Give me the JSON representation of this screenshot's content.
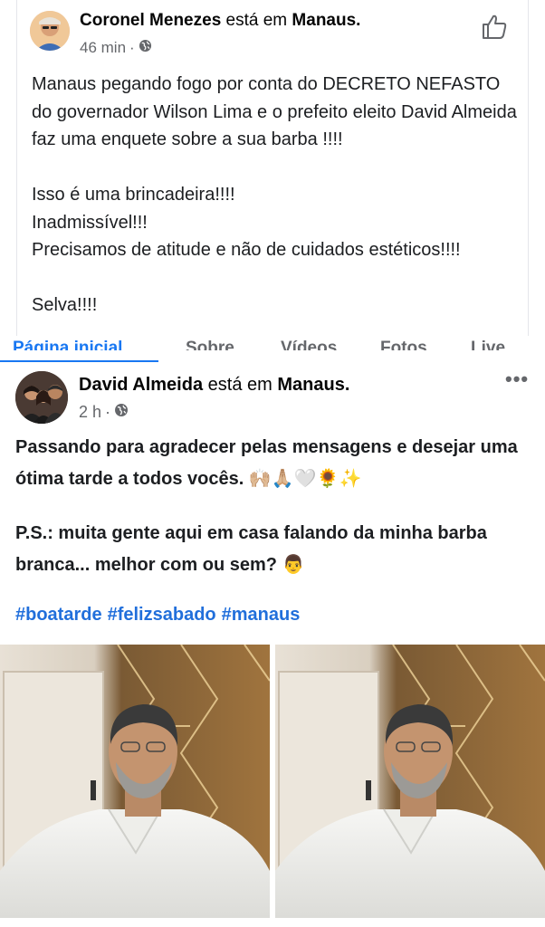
{
  "post1": {
    "author": "Coronel Menezes",
    "connector": "está em",
    "location": "Manaus.",
    "time": "46 min",
    "separator": "·",
    "icons": {
      "privacy": "globe-icon",
      "like": "thumbs-up-icon"
    },
    "paragraphs": [
      "Manaus pegando fogo por conta do DECRETO NEFASTO do governador Wilson Lima e o prefeito eleito David Almeida faz uma enquete sobre a sua barba !!!!",
      "Isso é uma brincadeira!!!!",
      "Inadmissível!!!",
      "Precisamos de atitude e não de cuidados estéticos!!!!",
      "Selva!!!!"
    ]
  },
  "tabs": [
    "Página inicial",
    "Sobre",
    "Vídeos",
    "Fotos",
    "Live"
  ],
  "post2": {
    "author": "David Almeida",
    "connector": "está em",
    "location": "Manaus.",
    "time": "2 h",
    "separator": "·",
    "more_label": "•••",
    "icons": {
      "privacy": "globe-icon",
      "more": "more-options-icon"
    },
    "paragraph1": "Passando para agradecer pelas mensagens e desejar uma ótima tarde a todos vocês.",
    "paragraph1_emojis": "🙌🏼🙏🏼🤍🌻✨",
    "paragraph2": "P.S.: muita gente aqui em casa falando da minha barba branca... melhor com ou sem?",
    "paragraph2_emoji": "👨",
    "hashtags": [
      "#boatarde",
      "#felizsabado",
      "#manaus"
    ],
    "photos": 2
  },
  "colors": {
    "text": "#1c1e21",
    "meta": "#65676b",
    "link": "#216fdb",
    "accent": "#1877f2"
  }
}
